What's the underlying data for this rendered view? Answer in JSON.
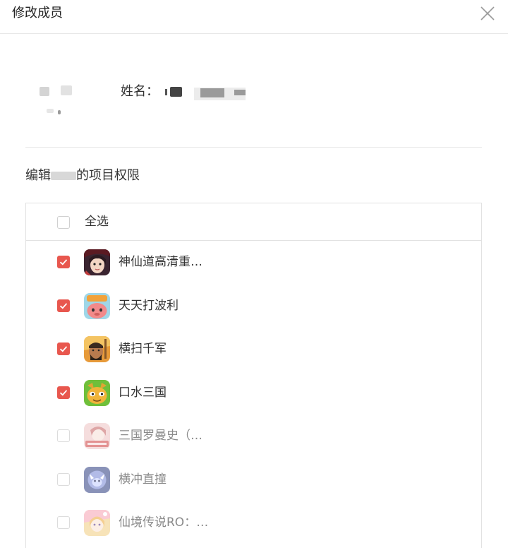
{
  "dialog": {
    "title": "修改成员",
    "close_icon": "close-icon"
  },
  "member": {
    "name_label": "姓名："
  },
  "permissions": {
    "title_prefix": "编辑",
    "title_suffix": "的项目权限",
    "select_all_label": "全选",
    "projects": [
      {
        "name": "神仙道高清重…",
        "checked": true,
        "enabled": true,
        "icon": "game-icon-shenxiandao"
      },
      {
        "name": "天天打波利",
        "checked": true,
        "enabled": true,
        "icon": "game-icon-tiantiandaboli"
      },
      {
        "name": "横扫千军",
        "checked": true,
        "enabled": true,
        "icon": "game-icon-hengsaoqianjun"
      },
      {
        "name": "口水三国",
        "checked": true,
        "enabled": true,
        "icon": "game-icon-koushuisanguo"
      },
      {
        "name": "三国罗曼史（…",
        "checked": false,
        "enabled": false,
        "icon": "game-icon-sanguoluomanshi"
      },
      {
        "name": "横冲直撞",
        "checked": false,
        "enabled": false,
        "icon": "game-icon-hengchongzhizhuang"
      },
      {
        "name": "仙境传说RO：…",
        "checked": false,
        "enabled": false,
        "icon": "game-icon-xianjingchuanshuo"
      }
    ]
  },
  "colors": {
    "accent": "#e8574e",
    "border": "#e2e2e2",
    "text": "#333333",
    "muted_text": "#8a8a8a"
  }
}
